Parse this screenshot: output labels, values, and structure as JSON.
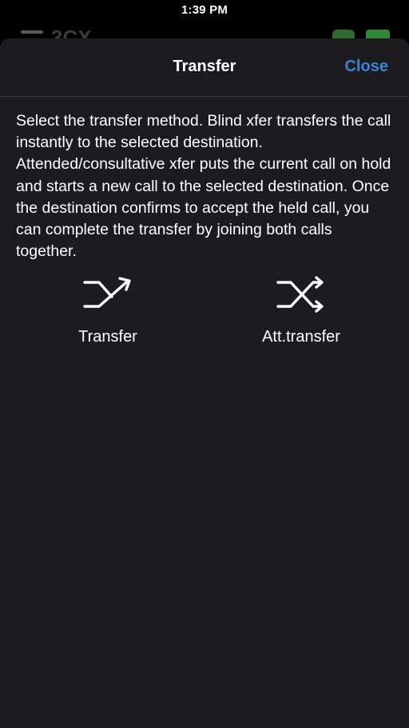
{
  "status_bar": {
    "time": "1:39 PM"
  },
  "background_app": {
    "logo_text": "3CX"
  },
  "sheet": {
    "title": "Transfer",
    "close_label": "Close",
    "description": "Select the transfer method. Blind xfer transfers the call instantly to the selected destination. Attended/consultative xfer puts the current call on hold and starts a new call to the selected destination. Once the destination confirms to accept the held call, you can complete the transfer by joining both calls together.",
    "options": [
      {
        "label": "Transfer",
        "icon": "blind-transfer-icon"
      },
      {
        "label": "Att.transfer",
        "icon": "attended-transfer-icon"
      }
    ]
  },
  "colors": {
    "sheet_background": "#1c1c1e",
    "accent": "#3b82d9",
    "text": "#ffffff"
  }
}
